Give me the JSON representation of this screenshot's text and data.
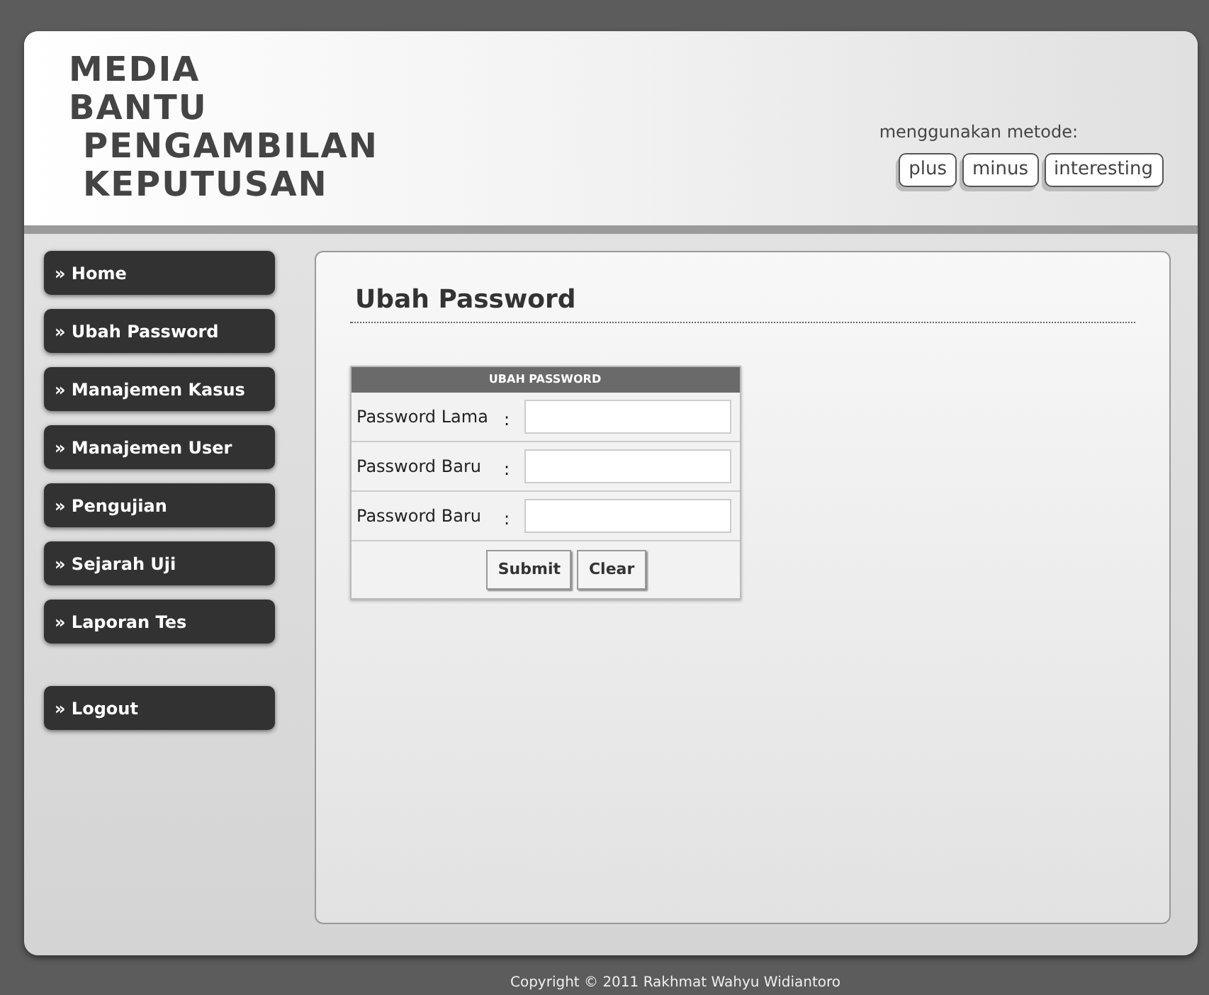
{
  "header": {
    "logo_lines": [
      "MEDIA",
      "BANTU",
      "PENGAMBILAN",
      "KEPUTUSAN"
    ],
    "tagline": "menggunakan metode:",
    "tags": [
      "plus",
      "minus",
      "interesting"
    ]
  },
  "sidebar": {
    "items": [
      {
        "label": "» Home"
      },
      {
        "label": "» Ubah Password"
      },
      {
        "label": "» Manajemen Kasus"
      },
      {
        "label": "» Manajemen User"
      },
      {
        "label": "» Pengujian"
      },
      {
        "label": "» Sejarah Uji"
      },
      {
        "label": "» Laporan Tes"
      }
    ],
    "logout": "» Logout"
  },
  "content": {
    "title": "Ubah Password",
    "form": {
      "header": "UBAH PASSWORD",
      "fields": [
        {
          "label": "Password Lama",
          "separator": ":"
        },
        {
          "label": "Password Baru",
          "separator": ":"
        },
        {
          "label": "Password Baru",
          "separator": ":"
        }
      ],
      "buttons": [
        "Submit",
        "Clear"
      ]
    }
  },
  "footer": "Copyright © 2011 Rakhmat Wahyu Widiantoro"
}
